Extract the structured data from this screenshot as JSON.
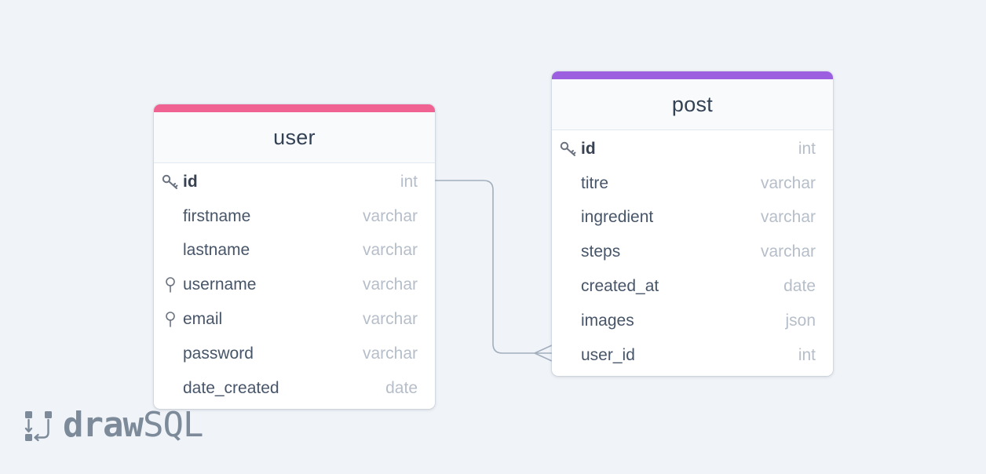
{
  "colors": {
    "background": "#f0f4f8",
    "user_accent": "#f06292",
    "post_accent": "#9c5fe0",
    "relation_line": "#a3aebd",
    "column_type": "#b6bec9"
  },
  "tables": {
    "user": {
      "name": "user",
      "columns": [
        {
          "name": "id",
          "type": "int",
          "icon": "key-icon"
        },
        {
          "name": "firstname",
          "type": "varchar",
          "icon": ""
        },
        {
          "name": "lastname",
          "type": "varchar",
          "icon": ""
        },
        {
          "name": "username",
          "type": "varchar",
          "icon": "unique-index-icon"
        },
        {
          "name": "email",
          "type": "varchar",
          "icon": "unique-index-icon"
        },
        {
          "name": "password",
          "type": "varchar",
          "icon": ""
        },
        {
          "name": "date_created",
          "type": "date",
          "icon": ""
        }
      ]
    },
    "post": {
      "name": "post",
      "columns": [
        {
          "name": "id",
          "type": "int",
          "icon": "key-icon"
        },
        {
          "name": "titre",
          "type": "varchar",
          "icon": ""
        },
        {
          "name": "ingredient",
          "type": "varchar",
          "icon": ""
        },
        {
          "name": "steps",
          "type": "varchar",
          "icon": ""
        },
        {
          "name": "created_at",
          "type": "date",
          "icon": ""
        },
        {
          "name": "images",
          "type": "json",
          "icon": ""
        },
        {
          "name": "user_id",
          "type": "int",
          "icon": ""
        }
      ]
    }
  },
  "relationship": {
    "from": "user.id",
    "to": "post.user_id",
    "cardinality": "one-to-many"
  },
  "logo": {
    "bold_part": "draw",
    "light_part": "SQL",
    "icon": "drawsql-logo-icon"
  }
}
